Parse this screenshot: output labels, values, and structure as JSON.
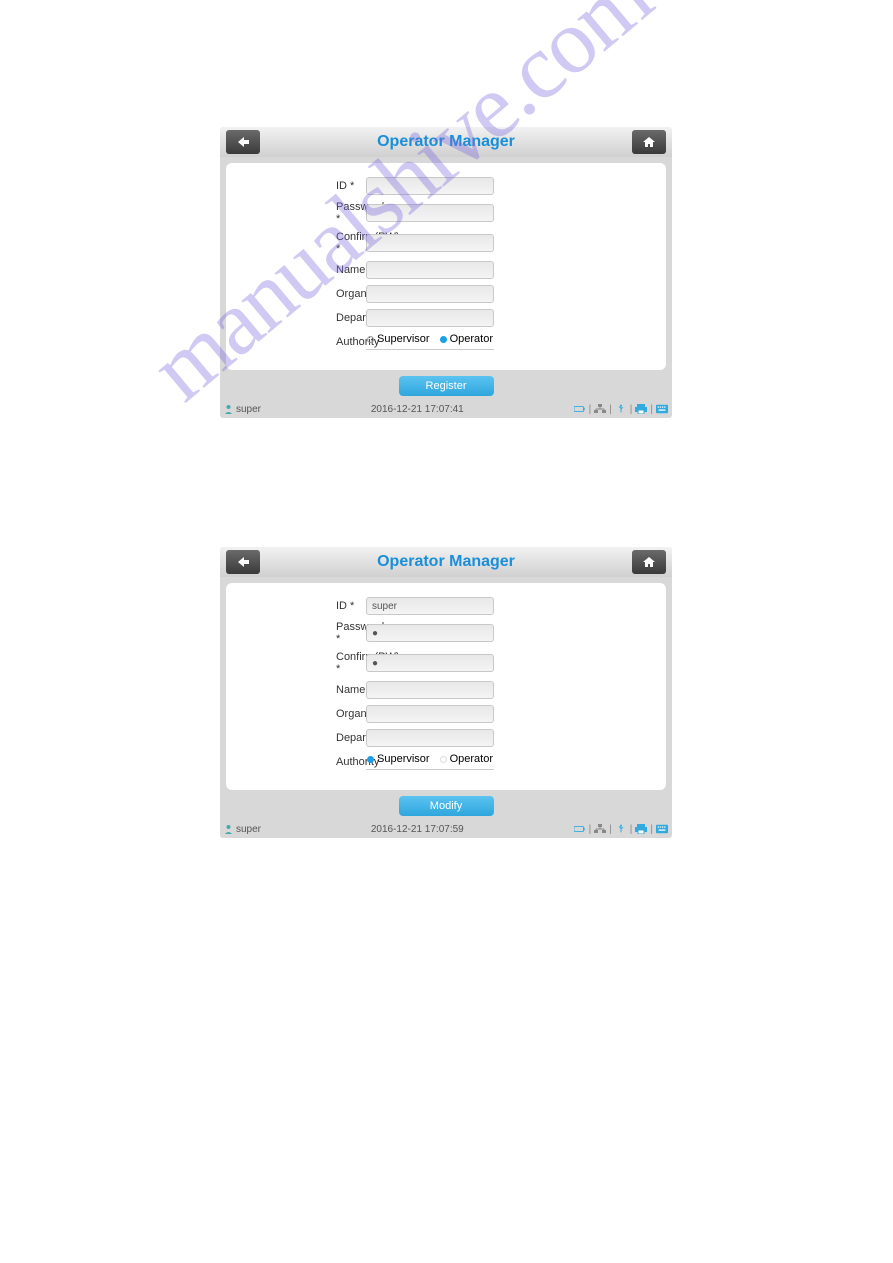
{
  "watermark_text": "manualshive.com",
  "screen1": {
    "title": "Operator Manager",
    "fields": {
      "id": {
        "label": "ID *",
        "value": ""
      },
      "password": {
        "label": "Password *",
        "value": ""
      },
      "confirm": {
        "label": "Confirm(PW) *",
        "value": ""
      },
      "name": {
        "label": "Name",
        "value": ""
      },
      "organization": {
        "label": "Organization",
        "value": ""
      },
      "department": {
        "label": "Department",
        "value": ""
      },
      "authority": {
        "label": "Authority",
        "opt1": "Supervisor",
        "opt2": "Operator",
        "selected": "Operator"
      }
    },
    "button": "Register",
    "status": {
      "user": "super",
      "datetime": "2016-12-21 17:07:41"
    }
  },
  "screen2": {
    "title": "Operator Manager",
    "fields": {
      "id": {
        "label": "ID *",
        "value": "super"
      },
      "password": {
        "label": "Password *",
        "value": "●"
      },
      "confirm": {
        "label": "Confirm(PW) *",
        "value": "●"
      },
      "name": {
        "label": "Name",
        "value": ""
      },
      "organization": {
        "label": "Organization",
        "value": ""
      },
      "department": {
        "label": "Department",
        "value": ""
      },
      "authority": {
        "label": "Authority",
        "opt1": "Supervisor",
        "opt2": "Operator",
        "selected": "Supervisor"
      }
    },
    "button": "Modify",
    "status": {
      "user": "super",
      "datetime": "2016-12-21 17:07:59"
    }
  }
}
